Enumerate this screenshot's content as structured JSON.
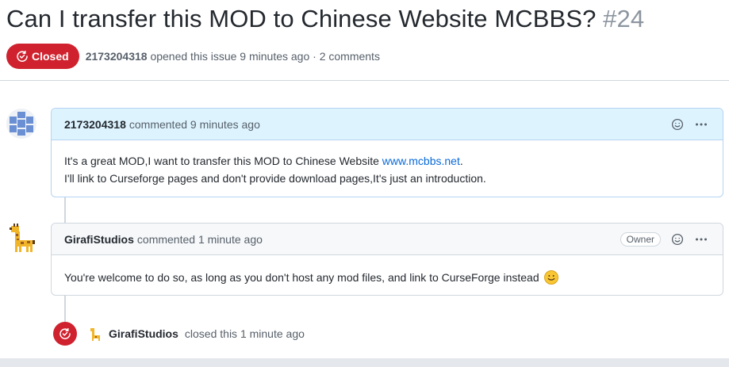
{
  "issue": {
    "title": "Can I transfer this MOD to Chinese Website MCBBS?",
    "number": "#24",
    "state": "Closed",
    "author": "2173204318",
    "opened_text": "opened this issue 9 minutes ago · 2 comments"
  },
  "comments": [
    {
      "author": "2173204318",
      "action": "commented 9 minutes ago",
      "body_line1_prefix": "It's a great MOD,I want to transfer this MOD to Chinese Website ",
      "body_link": "www.mcbbs.net",
      "body_line1_suffix": ".",
      "body_line2": "I'll link to Curseforge pages and don't provide download pages,It's just an introduction."
    },
    {
      "author": "GirafiStudios",
      "action": "commented 1 minute ago",
      "role_label": "Owner",
      "body": "You're welcome to do so, as long as you don't host any mod files, and link to CurseForge instead"
    }
  ],
  "event": {
    "actor": "GirafiStudios",
    "text": "closed this 1 minute ago"
  },
  "colors": {
    "closed_red": "#cf222e",
    "link_blue": "#0969da",
    "author_header_bg": "#ddf4ff"
  }
}
